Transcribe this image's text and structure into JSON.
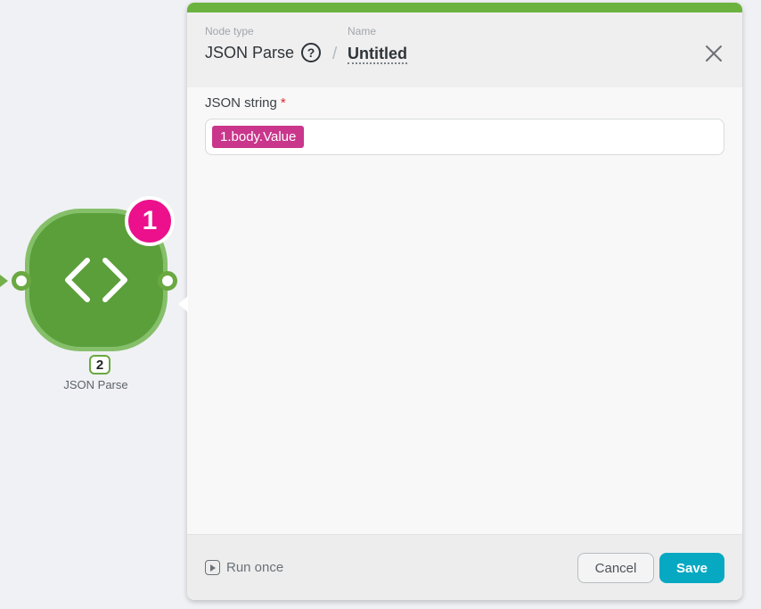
{
  "canvas": {
    "node": {
      "badge_count": "1",
      "id": "2",
      "label": "JSON Parse",
      "icon": "code-brackets-icon",
      "colors": {
        "fill": "#5b9f3b",
        "ring": "#86bf6a",
        "badge": "#ec108c"
      }
    }
  },
  "panel": {
    "accent_color": "#6bb23f",
    "header": {
      "node_type_label": "Node type",
      "node_type_value": "JSON Parse",
      "name_label": "Name",
      "name_value": "Untitled",
      "separator": "/",
      "help_icon": "help-circle-icon",
      "close_icon": "close-icon"
    },
    "field": {
      "label": "JSON string",
      "required_mark": "*",
      "value_pill": "1.body.Value",
      "pill_color": "#c9368b"
    },
    "footer": {
      "run_once_label": "Run once",
      "run_icon": "play-square-icon",
      "cancel_label": "Cancel",
      "save_label": "Save",
      "save_color": "#07a9c2"
    }
  }
}
